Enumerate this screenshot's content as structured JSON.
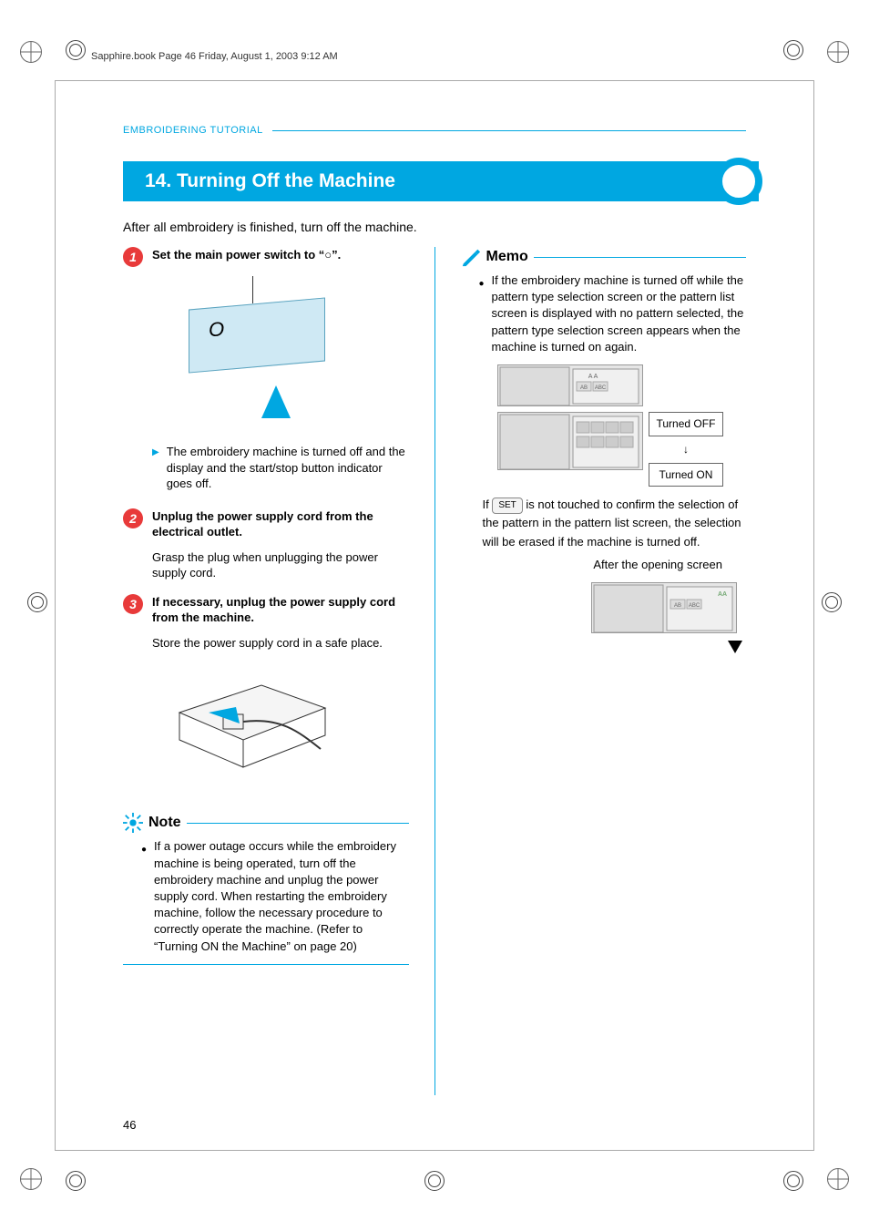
{
  "header_line": "Sapphire.book  Page 46  Friday, August 1, 2003  9:12 AM",
  "breadcrumb": "EMBROIDERING TUTORIAL",
  "section_title": "14. Turning Off the Machine",
  "intro": "After all embroidery is finished, turn off the machine.",
  "steps": {
    "s1": {
      "title": "Set the main power switch to “○”.",
      "outcome": "The embroidery machine is turned off and the display and the start/stop button indicator goes off."
    },
    "s2": {
      "title": "Unplug the power supply cord from the electrical outlet.",
      "body": "Grasp the plug when unplugging the power supply cord."
    },
    "s3": {
      "title": "If necessary, unplug the power supply cord from the machine.",
      "body": "Store the power supply cord in a safe place."
    }
  },
  "note": {
    "label": "Note",
    "body": "If a power outage occurs while the embroidery machine is being operated, turn off the embroidery machine and unplug the power supply cord. When restarting the embroidery machine, follow the necessary procedure to correctly operate the machine. (Refer to “Turning ON the Machine” on page 20)"
  },
  "memo": {
    "label": "Memo",
    "p1": "If the embroidery machine is turned off while the pattern type selection screen or the pattern list screen is displayed with no pattern selected, the pattern type selection screen appears when the machine is turned on again.",
    "turned_off": "Turned OFF",
    "down_arrow": "↓",
    "turned_on": "Turned ON",
    "p2a": "If ",
    "set": "SET",
    "p2b": " is not touched to confirm the selection of the pattern in the pattern list screen, the selection will be erased if the machine is turned off.",
    "after_opening": "After the opening screen"
  },
  "page_number": "46",
  "icons": {
    "switch_zero": "O"
  }
}
